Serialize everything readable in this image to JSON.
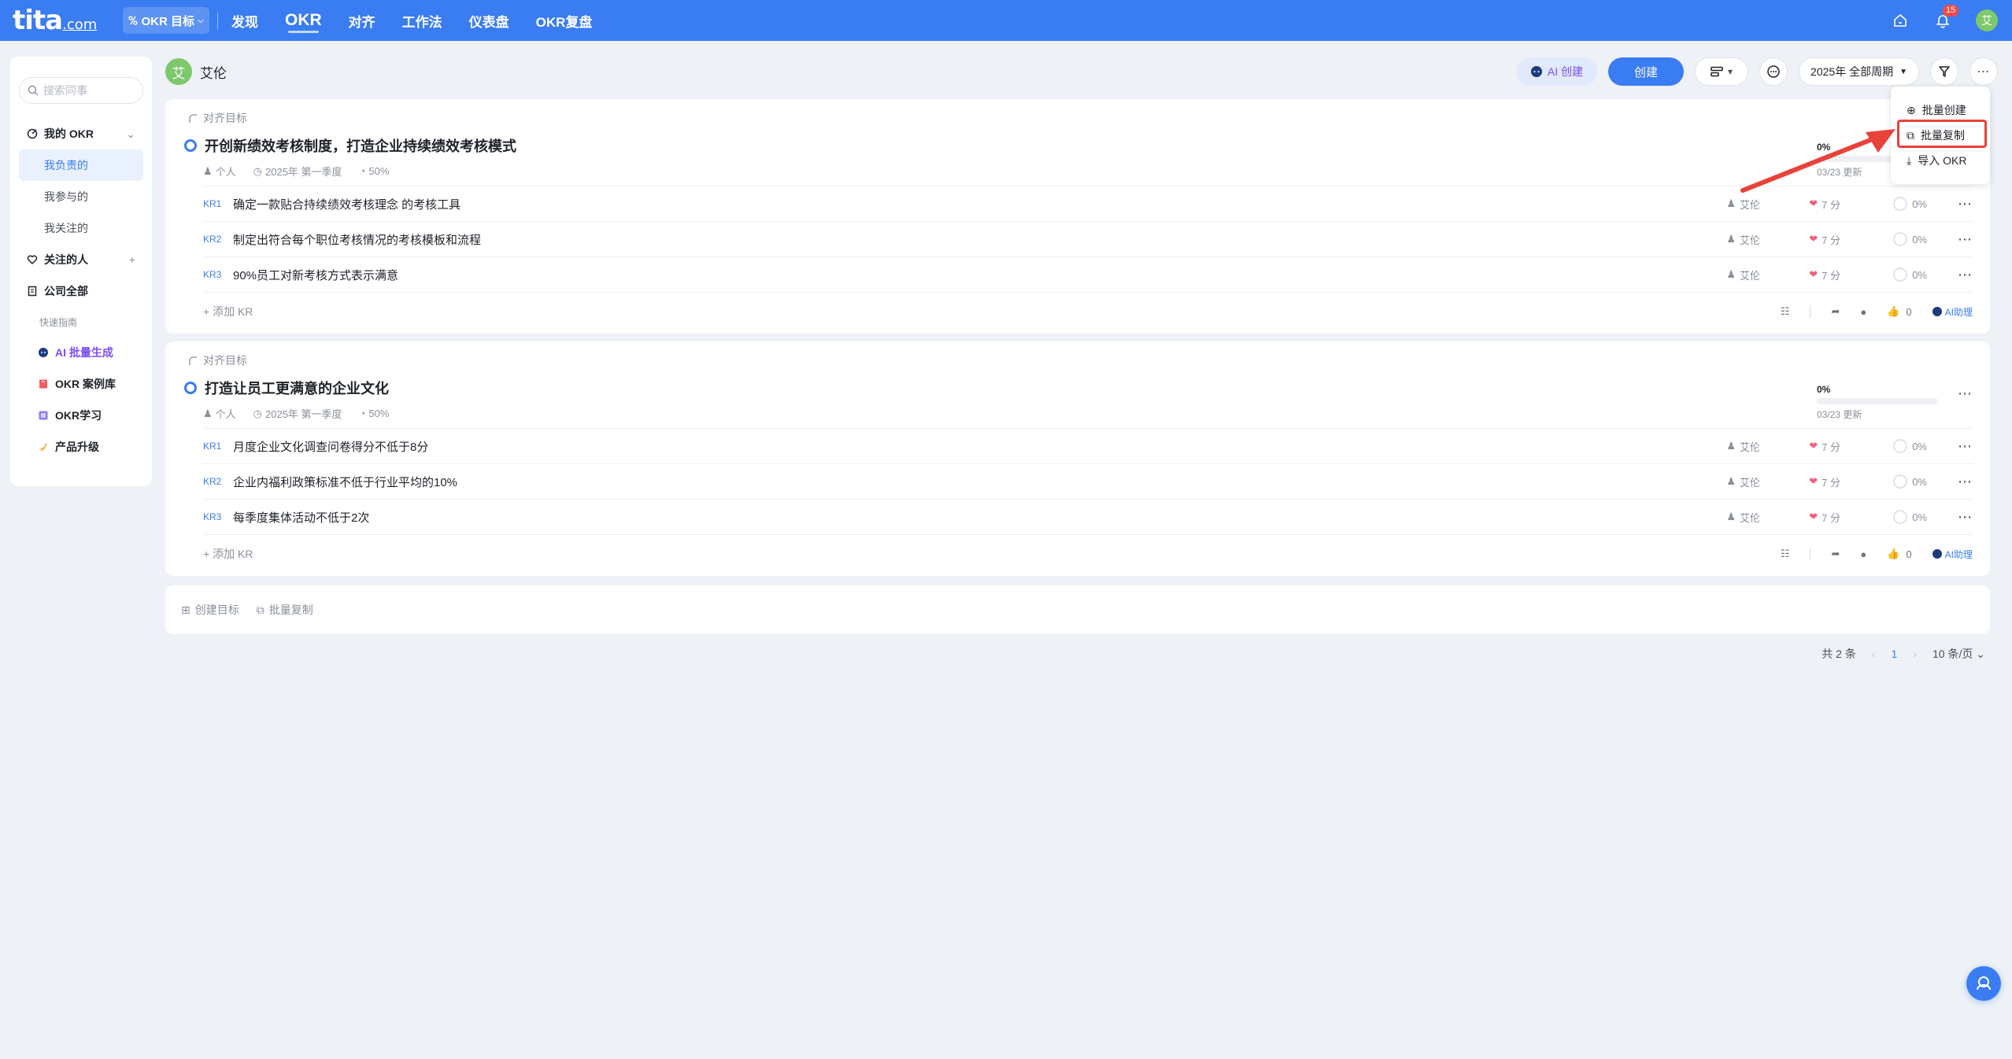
{
  "topbar": {
    "logo": "tita",
    "logo_suffix": ".com",
    "app_switch": "OKR 目标",
    "nav": [
      "发现",
      "OKR",
      "对齐",
      "工作法",
      "仪表盘",
      "OKR复盘"
    ],
    "notification_count": "15",
    "user_initial": "艾"
  },
  "sidebar": {
    "search_placeholder": "搜索同事",
    "my_okr": "我的 OKR",
    "my_okr_items": [
      "我负责的",
      "我参与的",
      "我关注的"
    ],
    "following": "关注的人",
    "company": "公司全部",
    "quick_guide": "快速指南",
    "quick_links": [
      "AI 批量生成",
      "OKR 案例库",
      "OKR学习",
      "产品升级"
    ]
  },
  "header": {
    "owner_initial": "艾",
    "owner_name": "艾伦",
    "ai_create": "AI 创建",
    "create": "创建",
    "period": "2025年 全部周期"
  },
  "objectives": [
    {
      "align_label": "对齐目标",
      "title": "开创新绩效考核制度，打造企业持续绩效考核模式",
      "type": "个人",
      "period": "2025年 第一季度",
      "weight": "50%",
      "progress": "0%",
      "progress_value": 0,
      "updated": "03/23 更新",
      "krs": [
        {
          "tag": "KR1",
          "text": "确定一款贴合持续绩效考核理念 的考核工具",
          "owner": "艾伦",
          "score": "7 分",
          "progress": "0%"
        },
        {
          "tag": "KR2",
          "text": "制定出符合每个职位考核情况的考核模板和流程",
          "owner": "艾伦",
          "score": "7 分",
          "progress": "0%"
        },
        {
          "tag": "KR3",
          "text": "90%员工对新考核方式表示满意",
          "owner": "艾伦",
          "score": "7 分",
          "progress": "0%"
        }
      ],
      "add_kr": "添加 KR",
      "like_count": "0",
      "ai_helper": "AI助理"
    },
    {
      "align_label": "对齐目标",
      "title": "打造让员工更满意的企业文化",
      "type": "个人",
      "period": "2025年 第一季度",
      "weight": "50%",
      "progress": "0%",
      "progress_value": 0,
      "updated": "03/23 更新",
      "krs": [
        {
          "tag": "KR1",
          "text": "月度企业文化调查问卷得分不低于8分",
          "owner": "艾伦",
          "score": "7 分",
          "progress": "0%"
        },
        {
          "tag": "KR2",
          "text": "企业内福利政策标准不低于行业平均的10%",
          "owner": "艾伦",
          "score": "7 分",
          "progress": "0%"
        },
        {
          "tag": "KR3",
          "text": "每季度集体活动不低于2次",
          "owner": "艾伦",
          "score": "7 分",
          "progress": "0%"
        }
      ],
      "add_kr": "添加 KR",
      "like_count": "0",
      "ai_helper": "AI助理"
    }
  ],
  "footer_actions": {
    "create_objective": "创建目标",
    "batch_copy": "批量复制"
  },
  "pagination": {
    "total": "共 2 条",
    "page": "1",
    "page_size": "10 条/页"
  },
  "dropdown": {
    "items": [
      "批量创建",
      "批量复制",
      "导入 OKR"
    ]
  },
  "colors": {
    "brand": "#3a7cf1",
    "highlight": "#e8423a",
    "ai": "#7d4cf3"
  }
}
